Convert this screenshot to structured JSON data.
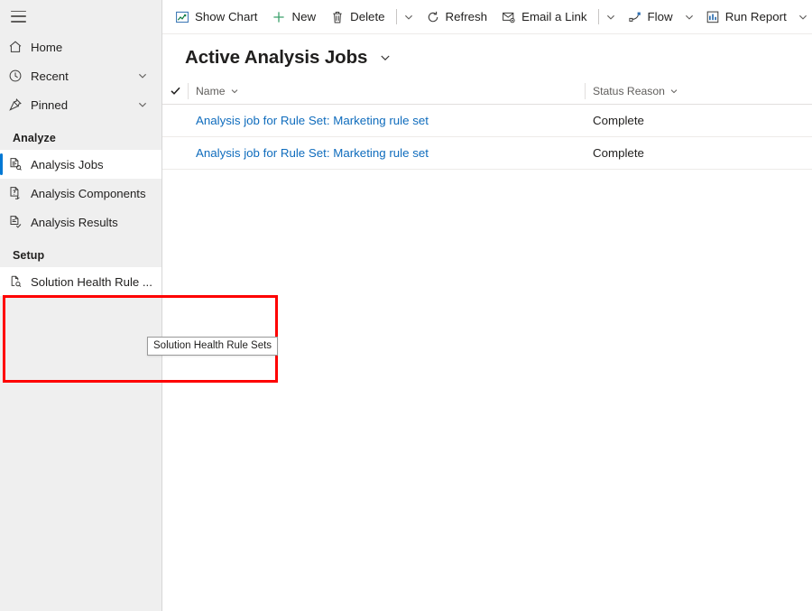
{
  "sidebar": {
    "menu_button": "hamburger-menu",
    "top_items": [
      {
        "label": "Home",
        "icon": "home-icon",
        "chevron": false
      },
      {
        "label": "Recent",
        "icon": "clock-icon",
        "chevron": true
      },
      {
        "label": "Pinned",
        "icon": "pin-icon",
        "chevron": true
      }
    ],
    "groups": [
      {
        "title": "Analyze",
        "items": [
          {
            "label": "Analysis Jobs",
            "icon": "analysis-jobs-icon",
            "selected": true,
            "hovered": false
          },
          {
            "label": "Analysis Components",
            "icon": "analysis-components-icon",
            "selected": false,
            "hovered": false
          },
          {
            "label": "Analysis Results",
            "icon": "analysis-results-icon",
            "selected": false,
            "hovered": false
          }
        ]
      },
      {
        "title": "Setup",
        "items": [
          {
            "label": "Solution Health Rule ...",
            "icon": "solution-health-rule-sets-icon",
            "selected": false,
            "hovered": true
          }
        ]
      }
    ],
    "tooltip": "Solution Health Rule Sets",
    "selection_accent_color": "#0078d4",
    "background_color": "#efefef"
  },
  "highlight": {
    "color": "#fe0000",
    "name": "solution-health-rule-sets-highlight"
  },
  "commandbar": {
    "items": [
      {
        "type": "button",
        "label": "Show Chart",
        "icon": "show-chart-icon"
      },
      {
        "type": "button",
        "label": "New",
        "icon": "plus-icon"
      },
      {
        "type": "button",
        "label": "Delete",
        "icon": "trash-icon"
      },
      {
        "type": "sep"
      },
      {
        "type": "caret",
        "label": "More commands (Delete group)"
      },
      {
        "type": "button",
        "label": "Refresh",
        "icon": "refresh-icon"
      },
      {
        "type": "button",
        "label": "Email a Link",
        "icon": "email-link-icon"
      },
      {
        "type": "sep"
      },
      {
        "type": "caret",
        "label": "More commands (Email group)"
      },
      {
        "type": "button",
        "label": "Flow",
        "icon": "flow-icon"
      },
      {
        "type": "caret",
        "label": "Flow options"
      },
      {
        "type": "button",
        "label": "Run Report",
        "icon": "run-report-icon"
      },
      {
        "type": "caret",
        "label": "Run Report options"
      }
    ]
  },
  "view": {
    "title": "Active Analysis Jobs",
    "title_caret": "chevron-down-icon"
  },
  "grid": {
    "select_all": "select-all-checkmark",
    "columns": [
      {
        "key": "name",
        "label": "Name"
      },
      {
        "key": "status",
        "label": "Status Reason"
      }
    ],
    "rows": [
      {
        "name": "Analysis job for Rule Set: Marketing rule set",
        "status": "Complete"
      },
      {
        "name": "Analysis job for Rule Set: Marketing rule set",
        "status": "Complete"
      }
    ]
  }
}
